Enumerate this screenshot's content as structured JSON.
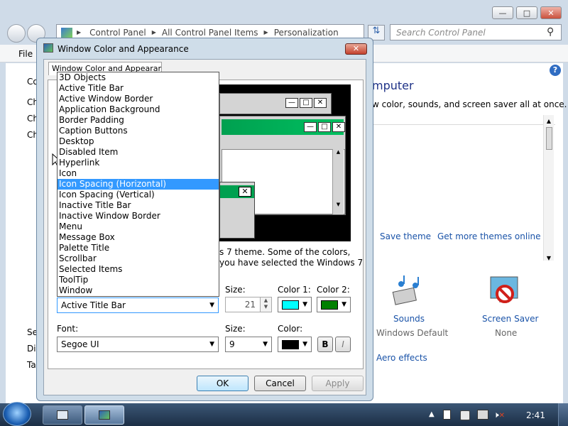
{
  "explorer": {
    "breadcrumb": [
      "Control Panel",
      "All Control Panel Items",
      "Personalization"
    ],
    "search_placeholder": "Search Control Panel",
    "menu_file": "File",
    "heading_partial": "mputer",
    "desc_partial": "w color, sounds, and screen saver all at once.",
    "save_theme": "Save theme",
    "get_more_themes": "Get more themes online",
    "sounds_label": "Sounds",
    "sounds_value": "Windows Default",
    "screensaver_label": "Screen Saver",
    "screensaver_value": "None",
    "aero_effects": "Aero effects",
    "left_partials": [
      "Co",
      "Ch",
      "Ch",
      "Ch",
      "Se",
      "Dis",
      "Ta"
    ]
  },
  "dialog": {
    "title": "Window Color and Appearance",
    "tab_label": "Window Color and Appearance",
    "info_line1": "s 7 theme.  Some of the colors,",
    "info_line2": "you have selected the Windows 7",
    "item_selected": "Active Title Bar",
    "size_label": "Size:",
    "size_value": "21",
    "color1_label": "Color 1:",
    "color2_label": "Color 2:",
    "color1": "#00ffff",
    "color2": "#008000",
    "font_label": "Font:",
    "font_value": "Segoe UI",
    "font_size_label": "Size:",
    "font_size_value": "9",
    "font_color_label": "Color:",
    "font_color": "#000000",
    "bold_label": "B",
    "italic_label": "I",
    "ok": "OK",
    "cancel": "Cancel",
    "apply": "Apply",
    "dropdown_items": [
      "3D Objects",
      "Active Title Bar",
      "Active Window Border",
      "Application Background",
      "Border Padding",
      "Caption Buttons",
      "Desktop",
      "Disabled Item",
      "Hyperlink",
      "Icon",
      "Icon Spacing (Horizontal)",
      "Icon Spacing (Vertical)",
      "Inactive Title Bar",
      "Inactive Window Border",
      "Menu",
      "Message Box",
      "Palette Title",
      "Scrollbar",
      "Selected Items",
      "ToolTip",
      "Window"
    ],
    "dropdown_highlight": "Icon Spacing (Horizontal)"
  },
  "taskbar": {
    "clock": "2:41"
  }
}
